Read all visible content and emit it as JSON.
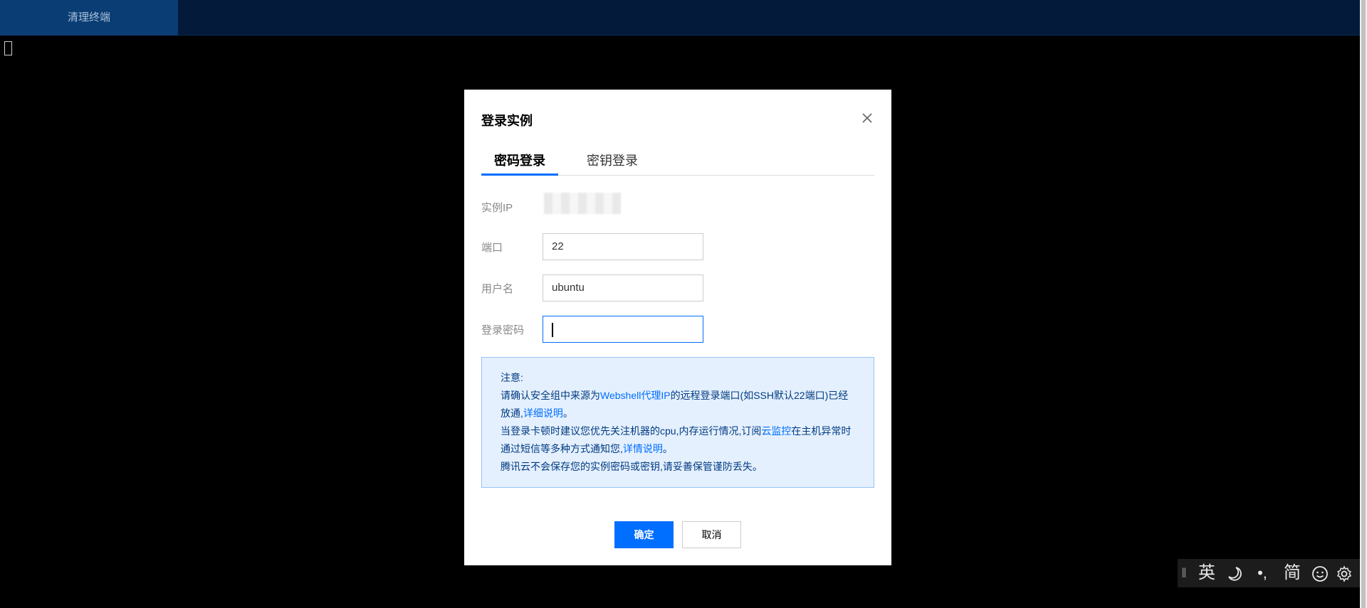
{
  "topbar": {
    "tab_label": "清理终端"
  },
  "dialog": {
    "title": "登录实例",
    "tabs": [
      {
        "label": "密码登录",
        "active": true
      },
      {
        "label": "密钥登录",
        "active": false
      }
    ],
    "fields": {
      "ip_label": "实例IP",
      "port_label": "端口",
      "port_value": "22",
      "username_label": "用户名",
      "username_value": "ubuntu",
      "password_label": "登录密码",
      "password_value": ""
    },
    "notice": {
      "heading": "注意:",
      "line1_pre": "请确认安全组中来源为",
      "line1_link": "Webshell代理IP",
      "line1_post": "的远程登录端口(如SSH默认22端口)已经放通,",
      "line1_link2": "详细说明",
      "line1_end": "。",
      "line2_pre": "当登录卡顿时建议您优先关注机器的cpu,内存运行情况,订阅",
      "line2_link": "云监控",
      "line2_post": "在主机异常时通过短信等多种方式通知您,",
      "line2_link2": "详情说明",
      "line2_end": "。",
      "line3": "腾讯云不会保存您的实例密码或密钥,请妥善保管谨防丢失。"
    },
    "buttons": {
      "ok": "确定",
      "cancel": "取消"
    }
  },
  "ime_toolbar": {
    "grip": "‖",
    "lang": "英",
    "moon_icon": "moon-icon",
    "punct": "•,",
    "script": "简",
    "emoji_icon": "smiley-icon",
    "settings_icon": "gear-icon"
  },
  "colors": {
    "topbar": "#031a3a",
    "active_tab": "#0a3d73",
    "accent": "#006eff",
    "notice_bg": "#e5f0ff",
    "notice_text": "#003b80"
  }
}
